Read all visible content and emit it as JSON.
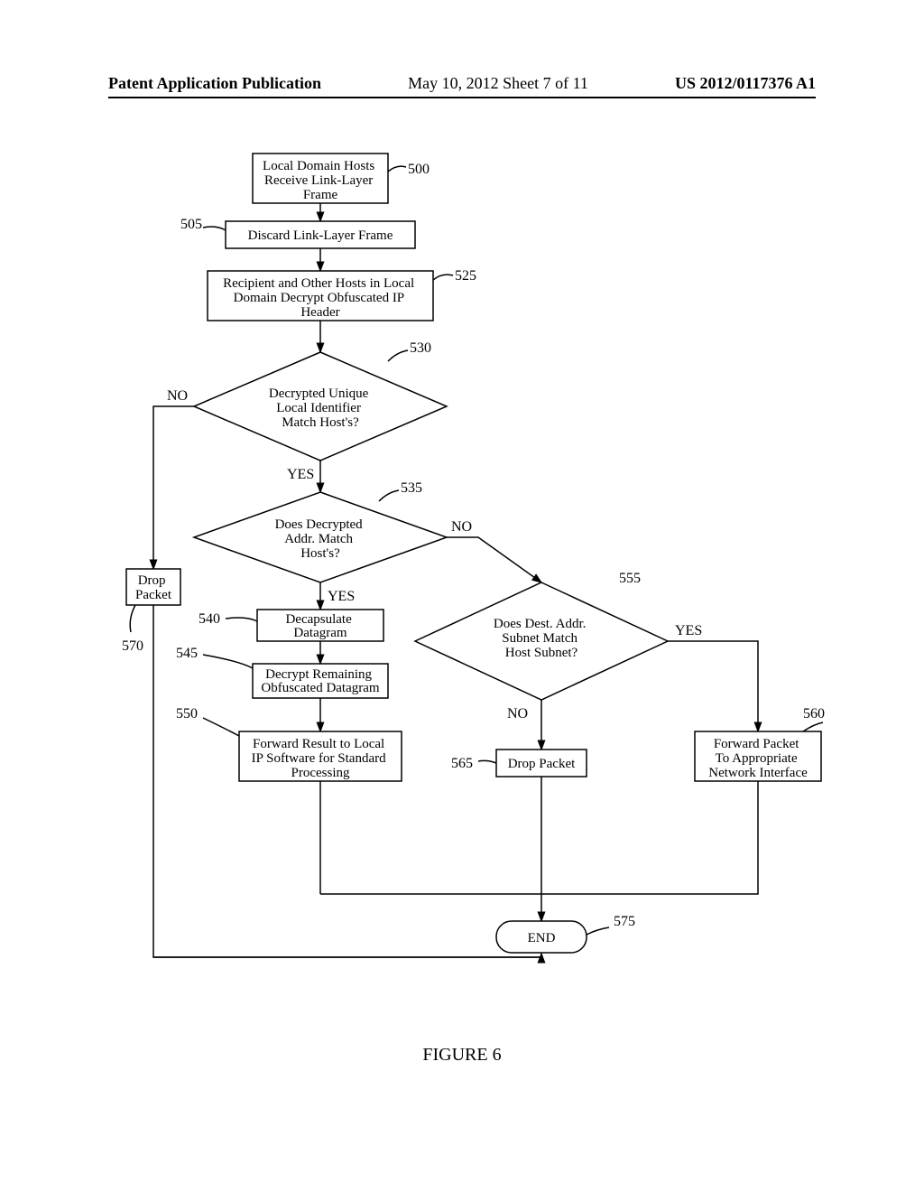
{
  "header": {
    "left": "Patent Application Publication",
    "mid": "May 10, 2012  Sheet 7 of 11",
    "right": "US 2012/0117376 A1"
  },
  "nodes": {
    "n500": "Local Domain Hosts Receive Link-Layer Frame",
    "n505": "Discard Link-Layer Frame",
    "n525": "Recipient and Other Hosts in Local Domain Decrypt Obfuscated IP Header",
    "n530": "Decrypted Unique Local Identifier Match Host's?",
    "n535": "Does Decrypted Addr. Match Host's?",
    "n540": "Decapsulate Datagram",
    "n545": "Decrypt Remaining Obfuscated Datagram",
    "n550": "Forward Result to Local IP Software for Standard Processing",
    "n555": "Does Dest. Addr. Subnet Match Host Subnet?",
    "n560": "Forward Packet To Appropriate Network Interface",
    "n565": "Drop Packet",
    "n570": "Drop Packet",
    "n575": "END"
  },
  "refs": {
    "r500": "500",
    "r505": "505",
    "r525": "525",
    "r530": "530",
    "r535": "535",
    "r540": "540",
    "r545": "545",
    "r550": "550",
    "r555": "555",
    "r560": "560",
    "r565": "565",
    "r570": "570",
    "r575": "575"
  },
  "edges": {
    "yes": "YES",
    "no": "NO"
  },
  "figure": "FIGURE 6"
}
